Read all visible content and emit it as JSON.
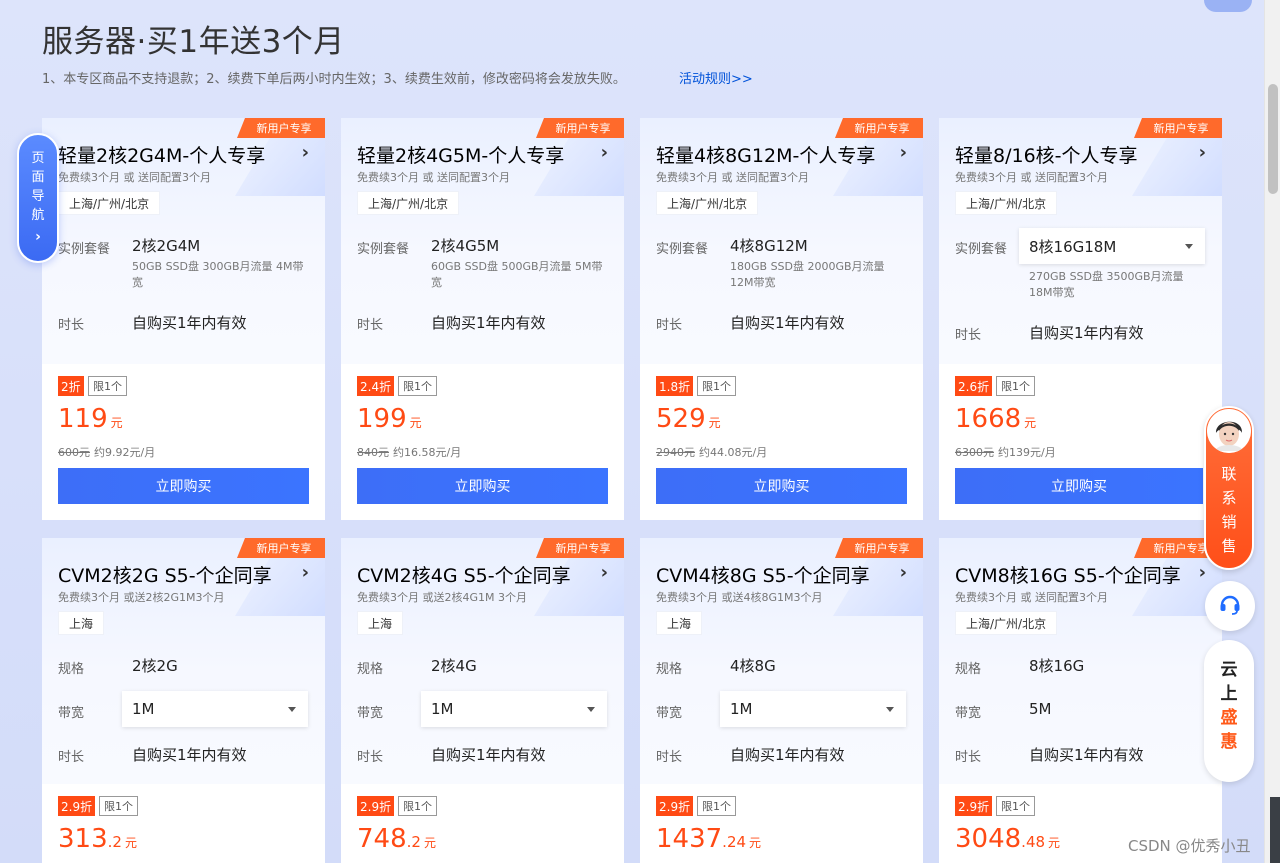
{
  "header": {
    "title": "服务器·买1年送3个月",
    "notice": "1、本专区商品不支持退款；2、续费下单后两小时内生效；3、续费生效前，修改密码将会发放失败。",
    "rules_link": "活动规则>>"
  },
  "side_nav": {
    "label": "页面导航",
    "arrow": "›"
  },
  "floating": {
    "contact_label": "联系销售",
    "cloud_promo_line1": "云上",
    "cloud_promo_line2": "盛惠"
  },
  "watermark": "CSDN @优秀小丑",
  "colors": {
    "accent": "#3d6ef7",
    "price": "#ff4a14",
    "ribbon": "#ff6a2b"
  },
  "cards": [
    {
      "ribbon": "新用户专享",
      "title": "轻量2核2G4M-个人专享",
      "subtitle": "免费续3个月 或 送同配置3个月",
      "region": "上海/广州/北京",
      "spec_label": "实例套餐",
      "spec_value": "2核2G4M",
      "spec_desc": "50GB SSD盘 300GB月流量 4M带宽",
      "duration_label": "时长",
      "duration_value": "自购买1年内有效",
      "discount": "2折",
      "limit": "限1个",
      "price_int": "119",
      "price_dec": "",
      "price_unit": "元",
      "orig_price": "600元",
      "monthly": "约9.92元/月",
      "buy_label": "立即购买"
    },
    {
      "ribbon": "新用户专享",
      "title": "轻量2核4G5M-个人专享",
      "subtitle": "免费续3个月 或 送同配置3个月",
      "region": "上海/广州/北京",
      "spec_label": "实例套餐",
      "spec_value": "2核4G5M",
      "spec_desc": "60GB SSD盘 500GB月流量 5M带宽",
      "duration_label": "时长",
      "duration_value": "自购买1年内有效",
      "discount": "2.4折",
      "limit": "限1个",
      "price_int": "199",
      "price_dec": "",
      "price_unit": "元",
      "orig_price": "840元",
      "monthly": "约16.58元/月",
      "buy_label": "立即购买"
    },
    {
      "ribbon": "新用户专享",
      "title": "轻量4核8G12M-个人专享",
      "subtitle": "免费续3个月 或 送同配置3个月",
      "region": "上海/广州/北京",
      "spec_label": "实例套餐",
      "spec_value": "4核8G12M",
      "spec_desc": "180GB SSD盘 2000GB月流量 12M带宽",
      "duration_label": "时长",
      "duration_value": "自购买1年内有效",
      "discount": "1.8折",
      "limit": "限1个",
      "price_int": "529",
      "price_dec": "",
      "price_unit": "元",
      "orig_price": "2940元",
      "monthly": "约44.08元/月",
      "buy_label": "立即购买"
    },
    {
      "ribbon": "新用户专享",
      "title": "轻量8/16核-个人专享",
      "subtitle": "免费续3个月 或 送同配置3个月",
      "region": "上海/广州/北京",
      "spec_label": "实例套餐",
      "spec_value": "8核16G18M",
      "spec_desc": "270GB SSD盘 3500GB月流量 18M带宽",
      "duration_label": "时长",
      "duration_value": "自购买1年内有效",
      "discount": "2.6折",
      "limit": "限1个",
      "price_int": "1668",
      "price_dec": "",
      "price_unit": "元",
      "orig_price": "6300元",
      "monthly": "约139元/月",
      "buy_label": "立即购买"
    },
    {
      "ribbon": "新用户专享",
      "title": "CVM2核2G S5-个企同享",
      "subtitle": "免费续3个月 或送2核2G1M3个月",
      "region": "上海",
      "spec_label": "规格",
      "spec_value": "2核2G",
      "bw_label": "带宽",
      "bw_value": "1M",
      "duration_label": "时长",
      "duration_value": "自购买1年内有效",
      "discount": "2.9折",
      "limit": "限1个",
      "price_int": "313",
      "price_dec": ".2",
      "price_unit": "元"
    },
    {
      "ribbon": "新用户专享",
      "title": "CVM2核4G S5-个企同享",
      "subtitle": "免费续3个月 或送2核4G1M 3个月",
      "region": "上海",
      "spec_label": "规格",
      "spec_value": "2核4G",
      "bw_label": "带宽",
      "bw_value": "1M",
      "duration_label": "时长",
      "duration_value": "自购买1年内有效",
      "discount": "2.9折",
      "limit": "限1个",
      "price_int": "748",
      "price_dec": ".2",
      "price_unit": "元"
    },
    {
      "ribbon": "新用户专享",
      "title": "CVM4核8G S5-个企同享",
      "subtitle": "免费续3个月 或送4核8G1M3个月",
      "region": "上海",
      "spec_label": "规格",
      "spec_value": "4核8G",
      "bw_label": "带宽",
      "bw_value": "1M",
      "duration_label": "时长",
      "duration_value": "自购买1年内有效",
      "discount": "2.9折",
      "limit": "限1个",
      "price_int": "1437",
      "price_dec": ".24",
      "price_unit": "元"
    },
    {
      "ribbon": "新用户专享",
      "title": "CVM8核16G S5-个企同享",
      "subtitle": "免费续3个月 或 送同配置3个月",
      "region": "上海/广州/北京",
      "spec_label": "规格",
      "spec_value": "8核16G",
      "bw_label": "带宽",
      "bw_value": "5M",
      "duration_label": "时长",
      "duration_value": "自购买1年内有效",
      "discount": "2.9折",
      "limit": "限1个",
      "price_int": "3048",
      "price_dec": ".48",
      "price_unit": "元"
    }
  ]
}
